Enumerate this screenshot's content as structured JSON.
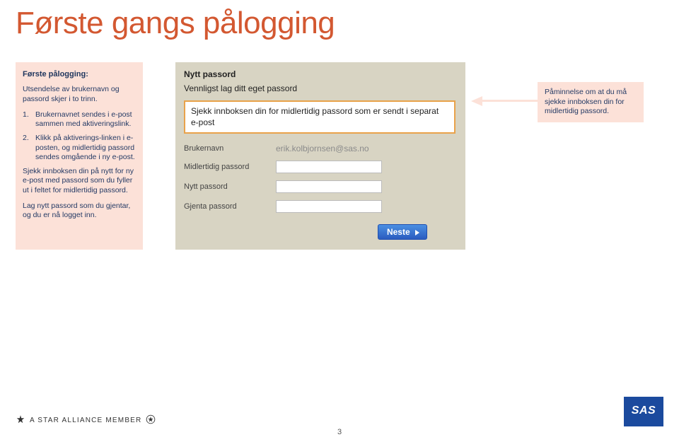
{
  "title": "Første gangs pålogging",
  "sidebar": {
    "heading": "Første pålogging:",
    "intro": "Utsendelse av brukernavn og passord skjer i to trinn.",
    "steps": [
      {
        "num": "1.",
        "text": "Brukernavnet sendes i e-post sammen med aktiveringslink."
      },
      {
        "num": "2.",
        "text": "Klikk på aktiverings-linken i e-posten, og midlertidig passord sendes omgående i ny e-post."
      }
    ],
    "para1": "Sjekk innboksen din på nytt for ny e-post med passord som du fyller ut i feltet for midlertidig passord.",
    "para2": "Lag nytt passord som du gjentar, og du er nå logget inn."
  },
  "panel": {
    "title": "Nytt passord",
    "subtitle": "Vennligst lag ditt eget passord",
    "notice": "Sjekk innboksen din for midlertidig passord som er sendt i separat e-post",
    "rows": {
      "brukernavn": "Brukernavn",
      "brukernavn_value": "erik.kolbjornsen@sas.no",
      "midlertidig": "Midlertidig passord",
      "nytt": "Nytt passord",
      "gjenta": "Gjenta passord"
    },
    "button": "Neste"
  },
  "callout": "Påminnelse om at du må sjekke innboksen din for midlertidig passord.",
  "footer": {
    "alliance": "A STAR ALLIANCE MEMBER",
    "logo": "SAS",
    "page": "3"
  }
}
